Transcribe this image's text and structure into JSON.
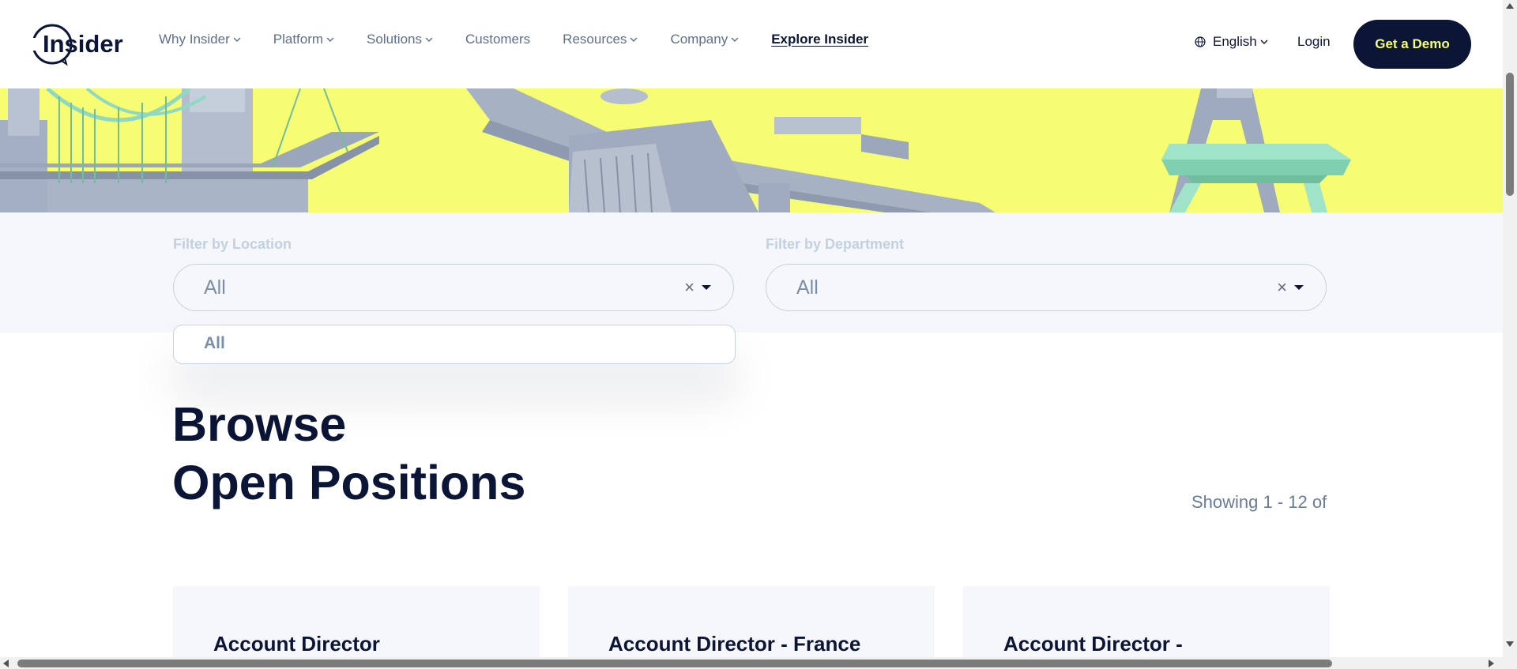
{
  "header": {
    "logo_text": "Insider",
    "nav": [
      {
        "label": "Why Insider",
        "dropdown": true
      },
      {
        "label": "Platform",
        "dropdown": true
      },
      {
        "label": "Solutions",
        "dropdown": true
      },
      {
        "label": "Customers",
        "dropdown": false
      },
      {
        "label": "Resources",
        "dropdown": true
      },
      {
        "label": "Company",
        "dropdown": true
      },
      {
        "label": "Explore Insider",
        "dropdown": false
      }
    ],
    "language": "English",
    "login": "Login",
    "cta": "Get a Demo"
  },
  "filters": {
    "location": {
      "label": "Filter by Location",
      "value": "All",
      "options": [
        "All"
      ]
    },
    "department": {
      "label": "Filter by Department",
      "value": "All"
    }
  },
  "positions": {
    "title_line1": "Browse",
    "title_line2": "Open Positions",
    "showing": "Showing 1 - 12 of",
    "cards": [
      {
        "title": "Account Director"
      },
      {
        "title": "Account Director - France"
      },
      {
        "title": "Account Director -"
      }
    ]
  },
  "colors": {
    "brand_navy": "#0b1535",
    "cta_text": "#f7ff6c",
    "hero_yellow": "#f7fd72",
    "filter_bg": "#f5f7fa"
  },
  "icons": {
    "globe": "globe-icon",
    "chevron": "chevron-down-icon",
    "clear": "close-icon",
    "caret": "caret-down-icon"
  }
}
